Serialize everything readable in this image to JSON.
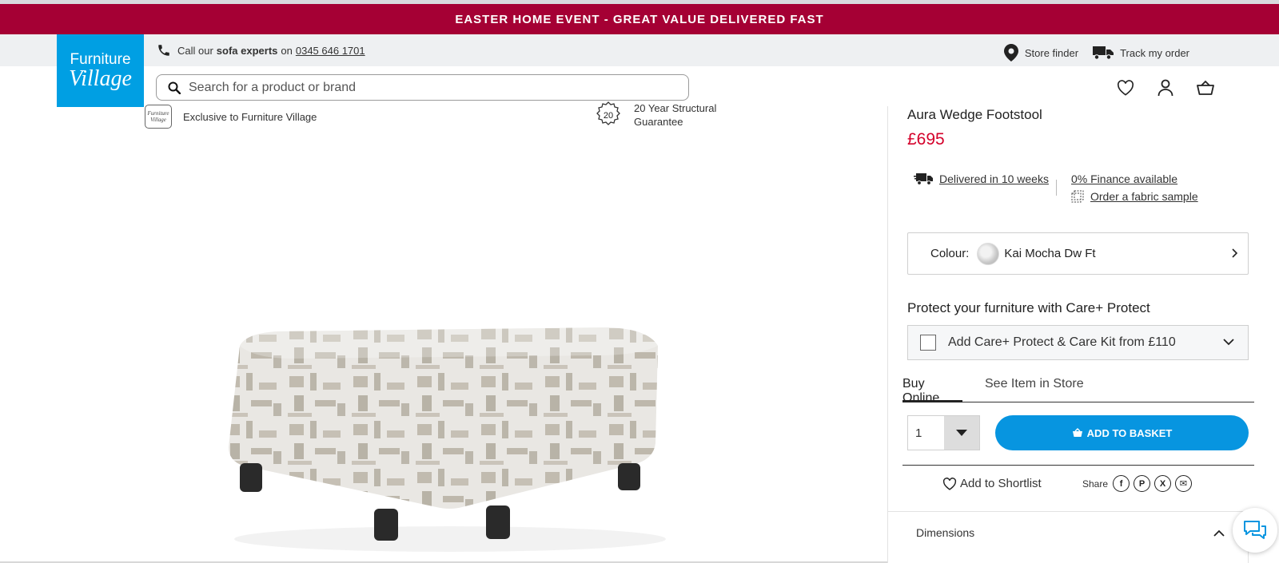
{
  "promo": {
    "text": "EASTER HOME EVENT - GREAT VALUE DELIVERED FAST"
  },
  "utility": {
    "call_prefix": "Call our",
    "call_bold": "sofa experts",
    "call_on": "on",
    "phone": "0345 646 1701",
    "store_finder": "Store finder",
    "track_order": "Track my order"
  },
  "logo": {
    "line1": "Furniture",
    "line2": "Village"
  },
  "search": {
    "placeholder": "Search for a product or brand"
  },
  "header_icons": [
    "heart-icon",
    "account-icon",
    "basket-icon"
  ],
  "usps": [
    {
      "text": "Exclusive to Furniture Village",
      "badge_line1": "Furniture",
      "badge_line2": "Village"
    },
    {
      "text": "20 Year Structural Guarantee",
      "badge": "20"
    }
  ],
  "product": {
    "title": "Aura Wedge Footstool",
    "price": "£695",
    "delivery": "Delivered in 10 weeks",
    "finance": "0% Finance available",
    "fabric_sample": "Order a fabric sample",
    "colour_label": "Colour:",
    "colour_value": "Kai Mocha Dw Ft"
  },
  "care": {
    "heading": "Protect your furniture with Care+ Protect",
    "option": "Add Care+ Protect & Care Kit from £110",
    "checked": false
  },
  "tabs": [
    {
      "label": "Buy Online",
      "active": true
    },
    {
      "label": "See Item in Store",
      "active": false
    }
  ],
  "purchase": {
    "quantity": "1",
    "add_to_basket": "ADD TO BASKET"
  },
  "actions": {
    "shortlist": "Add to Shortlist",
    "share_label": "Share",
    "share_icons": [
      "facebook-icon",
      "pinterest-icon",
      "x-icon",
      "email-icon"
    ],
    "share_glyphs": [
      "f",
      "P",
      "X",
      "✉"
    ]
  },
  "accordion": {
    "dimensions": "Dimensions"
  },
  "colors": {
    "promo_bg": "#a50034",
    "brand_blue": "#009fe3",
    "price_red": "#d4002a",
    "button_blue": "#0795e0"
  }
}
